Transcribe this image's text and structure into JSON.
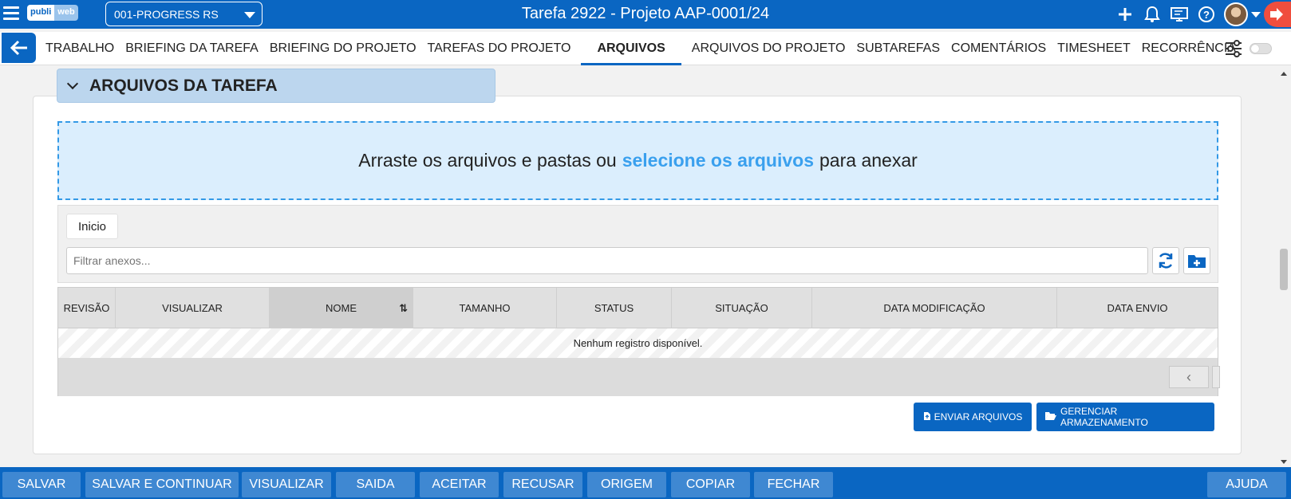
{
  "app": {
    "logo_part1": "publi",
    "logo_part2": "web",
    "company": "001-PROGRESS RS",
    "title": "Tarefa 2922 - Projeto AAP-0001/24",
    "top_icons": [
      "plus-icon",
      "bell-icon",
      "monitor-icon",
      "help-icon",
      "avatar",
      "chevron-down-icon",
      "exit-icon"
    ]
  },
  "tabs": [
    {
      "label": "TRABALHO",
      "active": false
    },
    {
      "label": "BRIEFING DA TAREFA",
      "active": false
    },
    {
      "label": "BRIEFING DO PROJETO",
      "active": false
    },
    {
      "label": "TAREFAS DO PROJETO",
      "active": false
    },
    {
      "label": "ARQUIVOS",
      "active": true
    },
    {
      "label": "ARQUIVOS DO PROJETO",
      "active": false
    },
    {
      "label": "SUBTAREFAS",
      "active": false
    },
    {
      "label": "COMENTÁRIOS",
      "active": false
    },
    {
      "label": "TIMESHEET",
      "active": false
    },
    {
      "label": "RECORRÊNCIA",
      "active": false
    }
  ],
  "section": {
    "title": "ARQUIVOS DA TAREFA"
  },
  "dropzone": {
    "text_before": "Arraste os arquivos e pastas ou",
    "link": "selecione os arquivos",
    "text_after": "para anexar"
  },
  "browser": {
    "breadcrumb": "Inicio",
    "filter_placeholder": "Filtrar anexos..."
  },
  "grid": {
    "columns": [
      "REVISÃO",
      "VISUALIZAR",
      "NOME",
      "TAMANHO",
      "STATUS",
      "SITUAÇÃO",
      "DATA MODIFICAÇÃO",
      "DATA ENVIO"
    ],
    "sorted_column": "NOME",
    "empty_message": "Nenhum registro disponível."
  },
  "actions": {
    "upload": "ENVIAR ARQUIVOS",
    "manage": "GERENCIAR ARMAZENAMENTO"
  },
  "bottom_buttons": [
    "SALVAR",
    "SALVAR E CONTINUAR",
    "VISUALIZAR",
    "SAIDA",
    "ACEITAR",
    "RECUSAR",
    "ORIGEM",
    "COPIAR",
    "FECHAR"
  ],
  "help_button": "AJUDA",
  "colors": {
    "primary": "#0a66c2",
    "bottom_button": "#3f88d2",
    "dropzone_bg": "#dbeefd",
    "link": "#3aa0ee",
    "exit": "#f04e3e"
  }
}
